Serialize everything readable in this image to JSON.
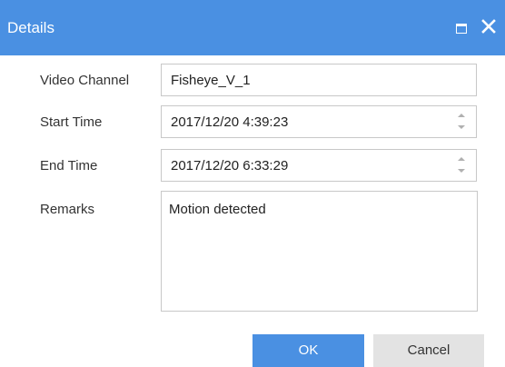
{
  "window": {
    "title": "Details",
    "maximize_icon": "maximize-icon",
    "close_icon": "close-icon",
    "title_bar_color": "#4a90e2"
  },
  "form": {
    "video_channel": {
      "label": "Video Channel",
      "value": "Fisheye_V_1"
    },
    "start_time": {
      "label": "Start Time",
      "value": "2017/12/20 4:39:23"
    },
    "end_time": {
      "label": "End Time",
      "value": "2017/12/20 6:33:29"
    },
    "remarks": {
      "label": "Remarks",
      "value": "Motion detected"
    }
  },
  "buttons": {
    "ok_label": "OK",
    "cancel_label": "Cancel",
    "ok_color": "#4a90e2"
  }
}
